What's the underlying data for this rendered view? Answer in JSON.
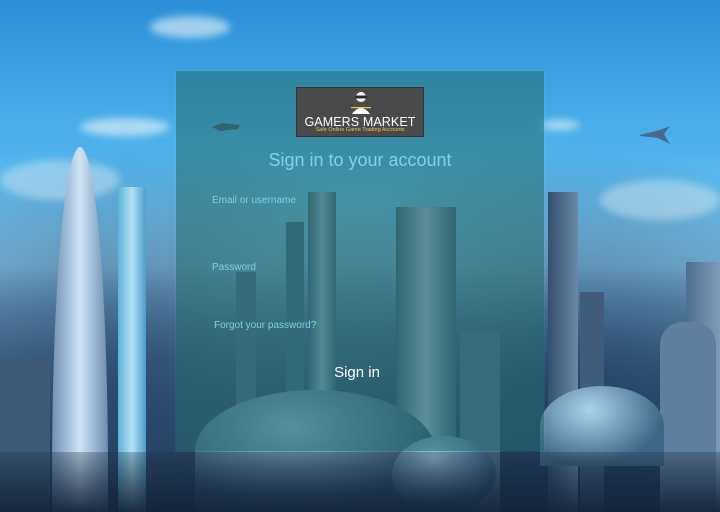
{
  "logo": {
    "title": "GAMERS MARKET",
    "subtitle": "Safe Online Game Trading Accounts"
  },
  "login": {
    "heading": "Sign in to your account",
    "email_label": "Email or username",
    "email_value": "",
    "password_label": "Password",
    "password_value": "",
    "forgot_link": "Forgot your password?",
    "submit_label": "Sign in"
  },
  "colors": {
    "accent_text": "#7fd3e6",
    "panel": "#286e6e",
    "logo_bg": "#4a4a4a",
    "logo_subtitle": "#f3c64a"
  }
}
